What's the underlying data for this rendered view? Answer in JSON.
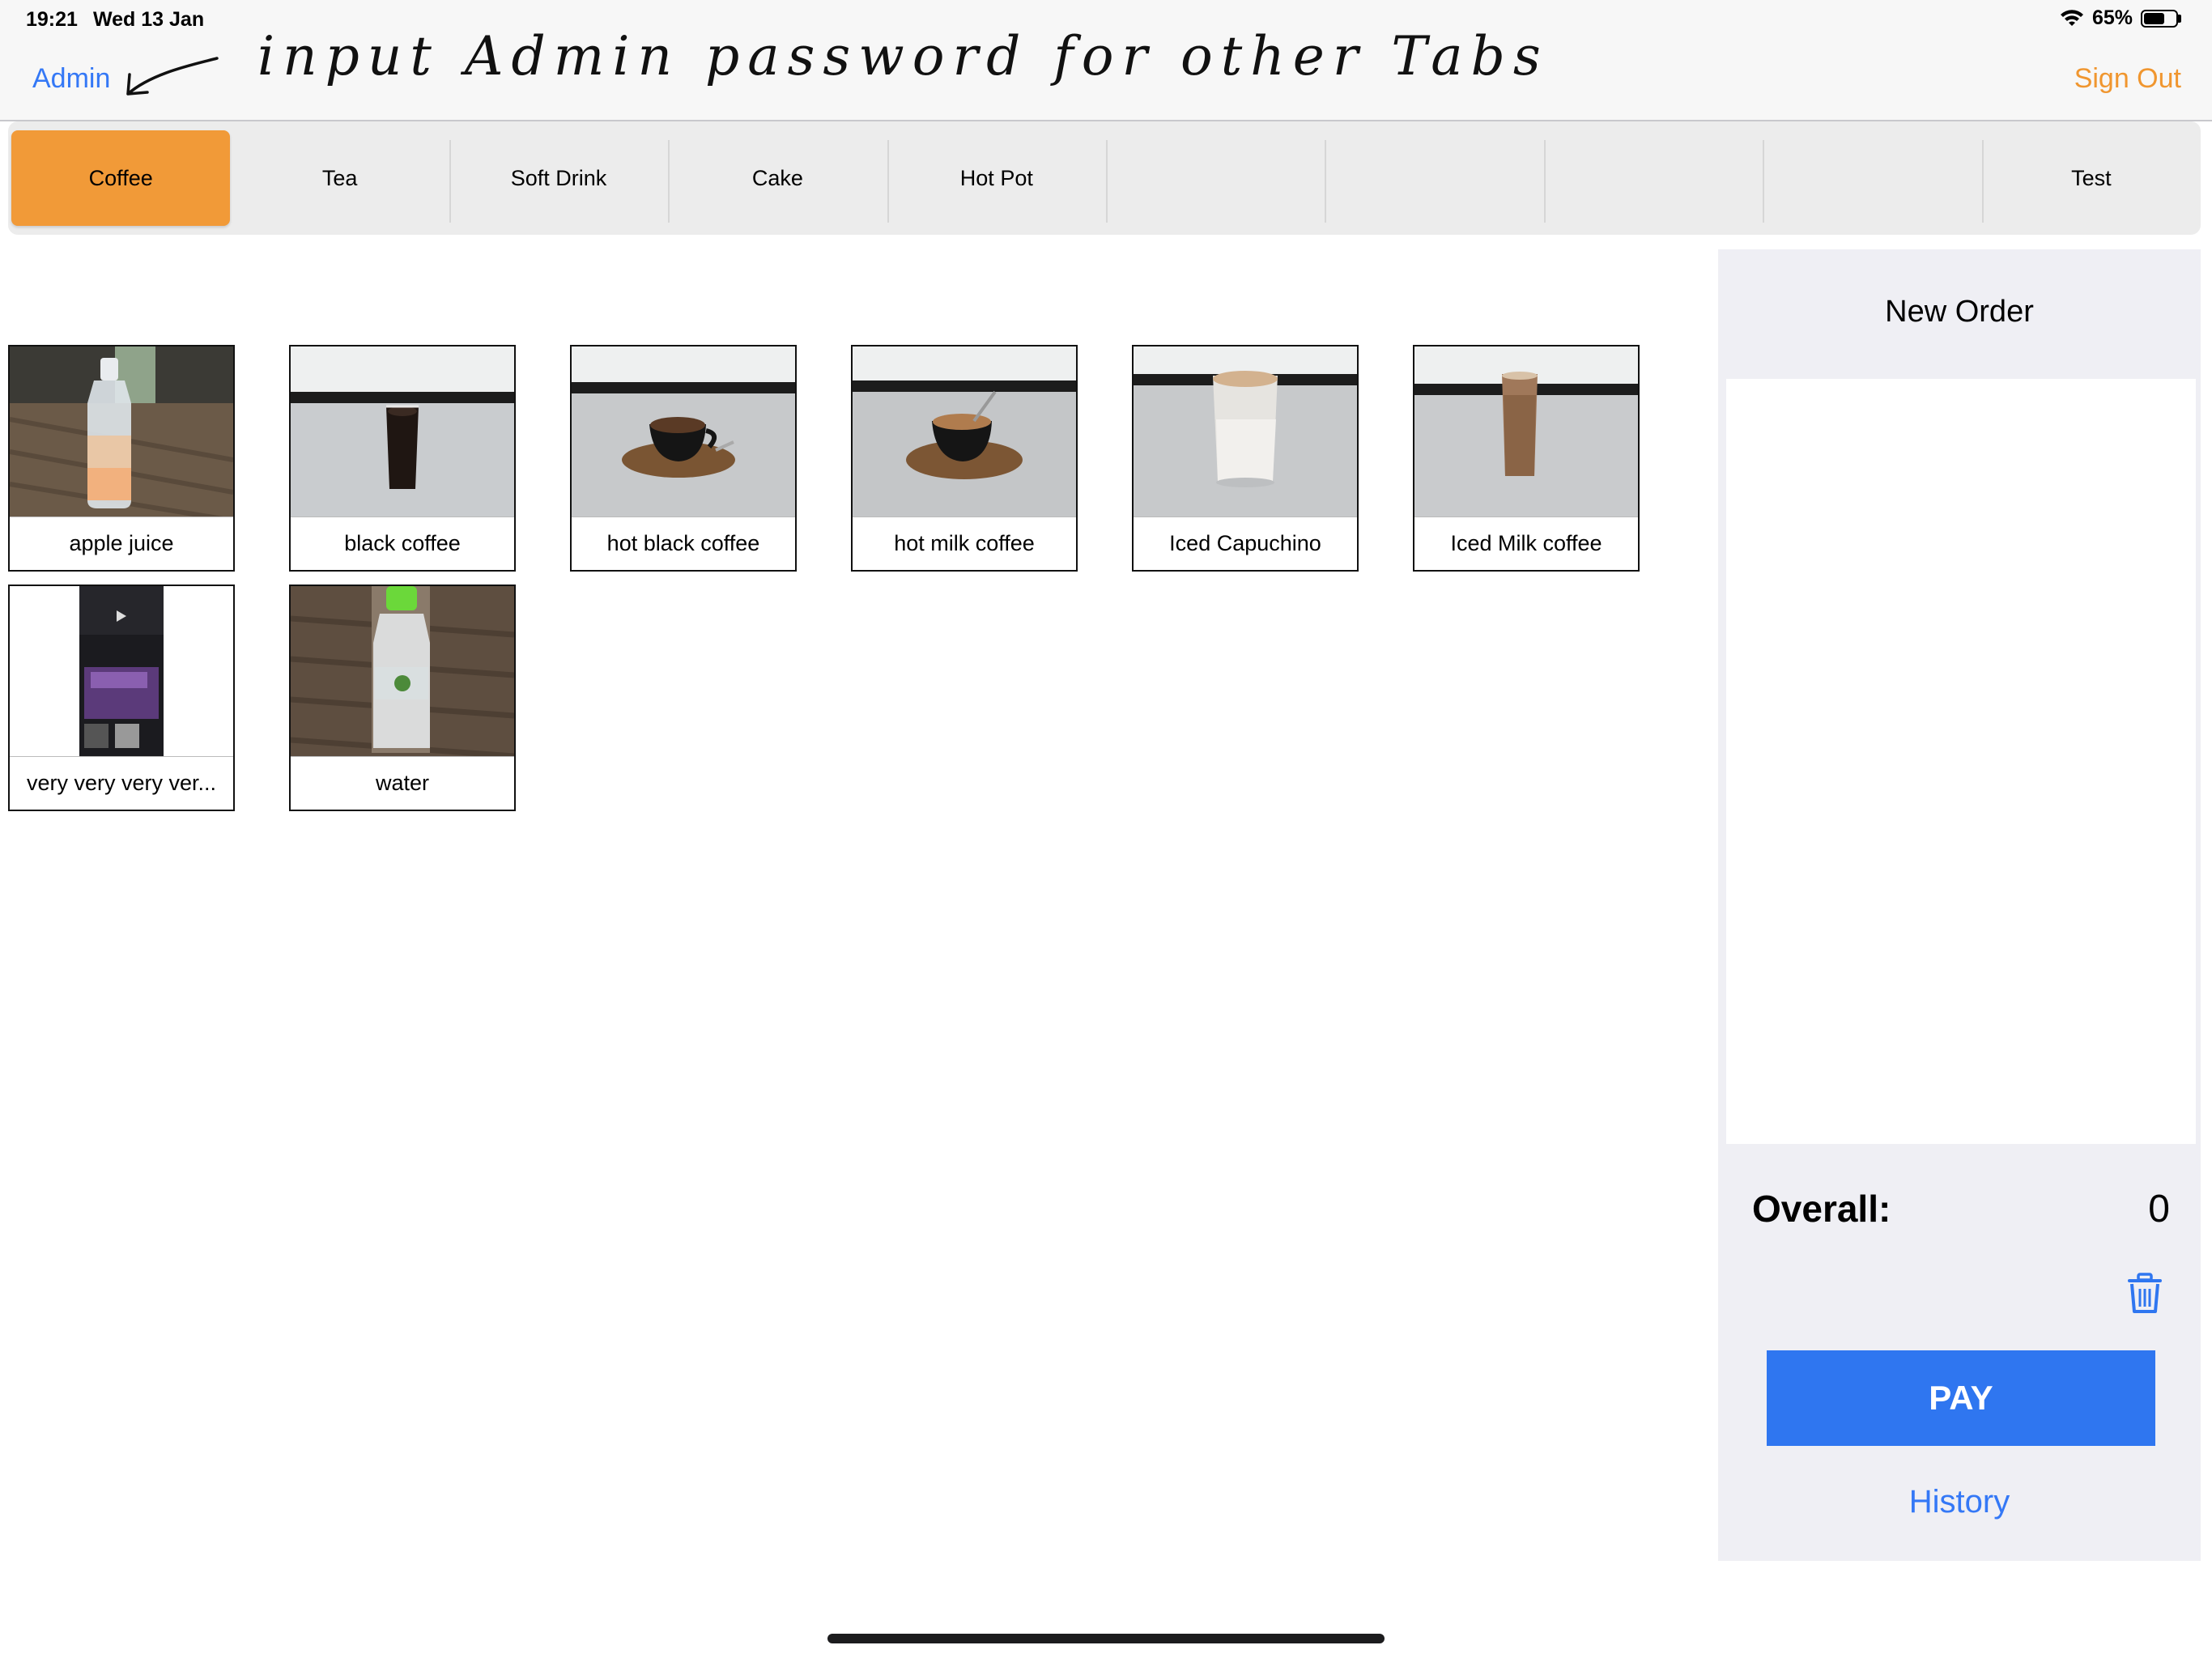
{
  "status_bar": {
    "time": "19:21",
    "date": "Wed 13 Jan",
    "battery_percent": "65%",
    "battery_level": 0.65
  },
  "nav": {
    "admin_label": "Admin",
    "sign_out_label": "Sign Out",
    "annotation": "input Admin password for other Tabs"
  },
  "categories": [
    {
      "label": "Coffee",
      "active": true
    },
    {
      "label": "Tea"
    },
    {
      "label": "Soft Drink"
    },
    {
      "label": "Cake"
    },
    {
      "label": "Hot Pot"
    },
    {
      "label": ""
    },
    {
      "label": ""
    },
    {
      "label": ""
    },
    {
      "label": ""
    },
    {
      "label": "Test"
    }
  ],
  "products": [
    {
      "name": "apple juice",
      "image": "bottle-on-floor"
    },
    {
      "name": "black coffee",
      "image": "iced-black-coffee-glass"
    },
    {
      "name": "hot black coffee",
      "image": "black-coffee-cup"
    },
    {
      "name": "hot milk coffee",
      "image": "milk-coffee-cup"
    },
    {
      "name": "Iced Capuchino",
      "image": "iced-cappuccino-glass"
    },
    {
      "name": "Iced Milk coffee",
      "image": "iced-milk-coffee-glass"
    },
    {
      "name": "very very very ver...",
      "image": "phone-screenshot"
    },
    {
      "name": "water",
      "image": "water-bottle"
    }
  ],
  "order": {
    "title": "New Order",
    "overall_label": "Overall:",
    "overall_value": "0",
    "pay_label": "PAY",
    "history_label": "History"
  },
  "colors": {
    "accent_blue": "#3478f6",
    "pay_blue": "#2f76f0",
    "orange": "#f19a38",
    "sign_out_orange": "#f0962f"
  }
}
